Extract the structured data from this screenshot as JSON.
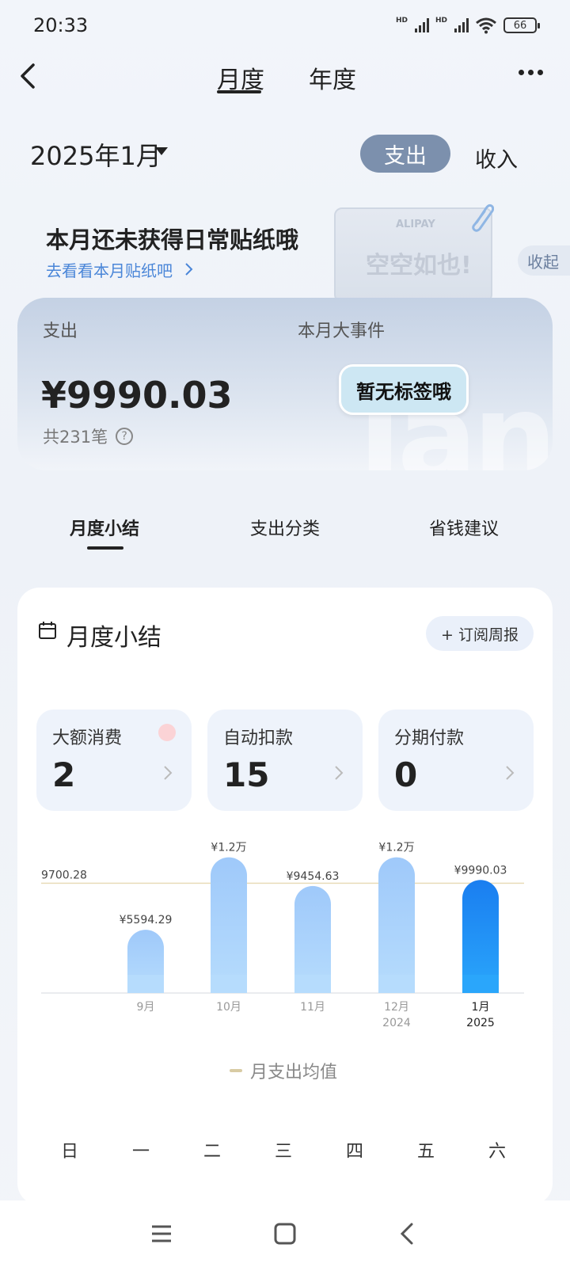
{
  "status_bar": {
    "time": "20:33",
    "battery": "66",
    "hd1": "HD",
    "hd2": "HD"
  },
  "nav": {
    "tab_month": "月度",
    "tab_year": "年度"
  },
  "month_selector": {
    "label": "2025年1月",
    "expense": "支出",
    "income": "收入"
  },
  "sticker": {
    "title": "本月还未获得日常贴纸哦",
    "link": "去看看本月贴纸吧",
    "brand": "ALIPAY",
    "empty_text": "空空如也!",
    "collapse": "收起"
  },
  "summary": {
    "label": "支出",
    "event_label": "本月大事件",
    "amount": "¥9990.03",
    "count": "共231笔",
    "no_tag": "暂无标签哦",
    "watermark": "Jan"
  },
  "sub_tabs": [
    "月度小结",
    "支出分类",
    "省钱建议"
  ],
  "monthly_summary": {
    "title": "月度小结",
    "subscribe": "+ 订阅周报",
    "stats": [
      {
        "label": "大额消费",
        "value": "2"
      },
      {
        "label": "自动扣款",
        "value": "15"
      },
      {
        "label": "分期付款",
        "value": "0"
      }
    ]
  },
  "chart_data": {
    "type": "bar",
    "categories": [
      "9月",
      "10月",
      "11月",
      "12月",
      "1月"
    ],
    "category_sublabels": [
      "",
      "",
      "",
      "2024",
      "2025"
    ],
    "values": [
      5594.29,
      12000,
      9454.63,
      12000,
      9990.03
    ],
    "value_labels": [
      "¥5594.29",
      "¥1.2万",
      "¥9454.63",
      "¥1.2万",
      "¥9990.03"
    ],
    "average": 9700.28,
    "average_label": "9700.28",
    "legend": "月支出均值",
    "highlight_index": 4,
    "ylim": [
      0,
      12600
    ]
  },
  "weekdays": [
    "日",
    "一",
    "二",
    "三",
    "四",
    "五",
    "六"
  ],
  "colors": {
    "bar": "#a9d2fb",
    "bar_highlight": "#1f88f0",
    "avg_line": "#e8dcb8",
    "accent": "#4a86d8"
  }
}
